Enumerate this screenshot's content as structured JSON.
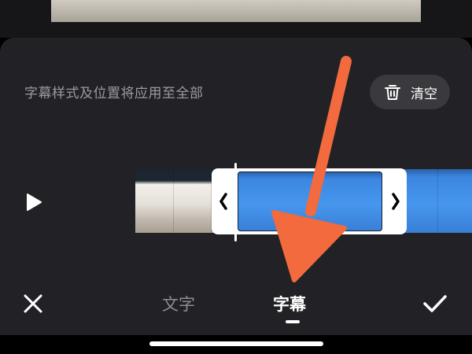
{
  "video_preview": {
    "description_icon": "video-frame"
  },
  "hint_text": "字幕样式及位置将应用至全部",
  "clear_button": {
    "label": "清空",
    "icon": "trash-icon"
  },
  "play_button": {
    "icon": "play-icon"
  },
  "timeline": {
    "selection_handles": {
      "left_icon": "chevron-left-icon",
      "right_icon": "chevron-right-icon"
    },
    "clip_color": "#4696ee"
  },
  "bottom_bar": {
    "close_icon": "close-icon",
    "confirm_icon": "check-icon",
    "tabs": [
      {
        "label": "文字",
        "active": false
      },
      {
        "label": "字幕",
        "active": true
      }
    ]
  },
  "annotation": {
    "arrow_color": "#f26a3d"
  },
  "colors": {
    "panel_background": "#222226",
    "accent_blue": "#4696ee",
    "active_tab": "#ffffff",
    "inactive_tab": "#8d8d92"
  }
}
